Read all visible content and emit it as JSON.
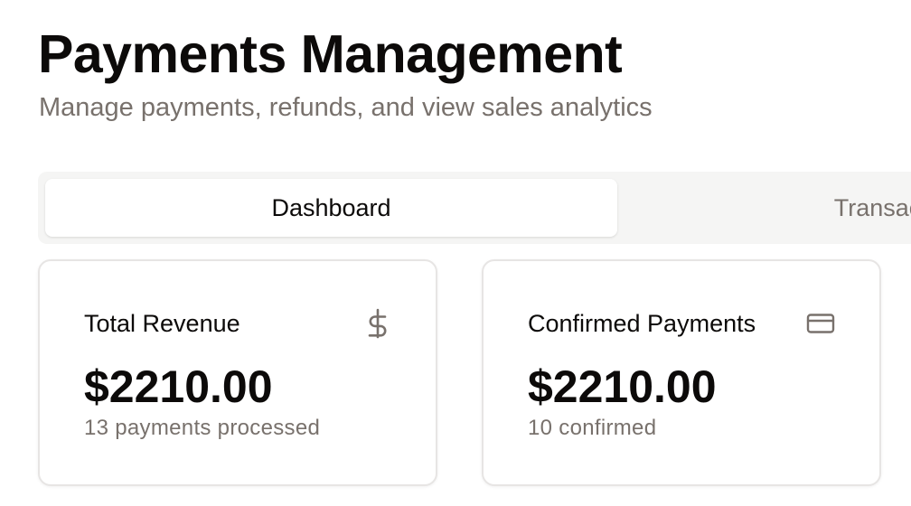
{
  "header": {
    "title": "Payments Management",
    "subtitle": "Manage payments, refunds, and view sales analytics"
  },
  "tabs": [
    {
      "label": "Dashboard",
      "active": true
    },
    {
      "label": "Transactions",
      "active": false
    }
  ],
  "cards": [
    {
      "title": "Total Revenue",
      "icon": "dollar-icon",
      "value": "$2210.00",
      "note": "13 payments processed"
    },
    {
      "title": "Confirmed Payments",
      "icon": "credit-card-icon",
      "value": "$2210.00",
      "note": "10 confirmed"
    }
  ],
  "colors": {
    "text_primary": "#0c0a09",
    "text_muted": "#78716c",
    "tab_bar_bg": "#f5f5f4",
    "card_border": "#e7e5e4"
  }
}
